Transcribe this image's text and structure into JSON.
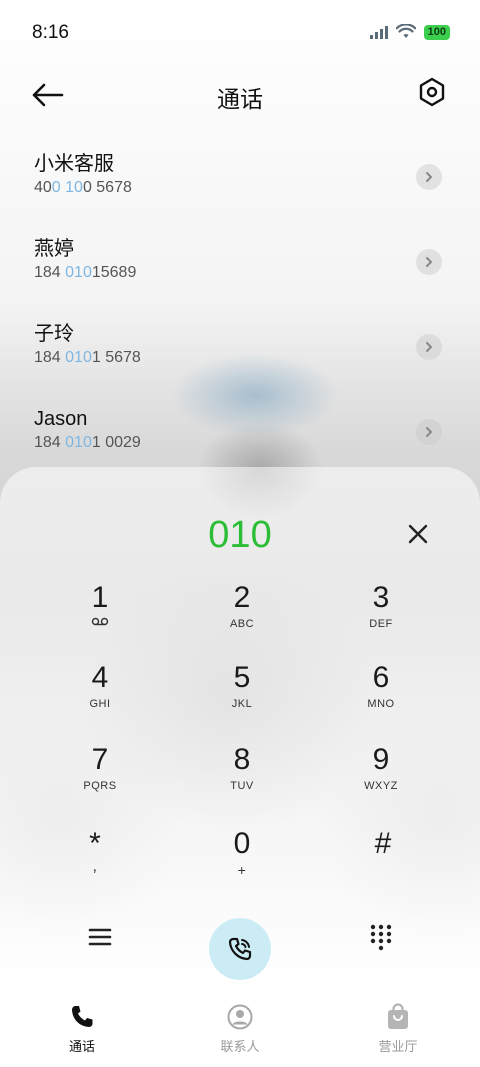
{
  "status_bar": {
    "time": "8:16",
    "battery": "100",
    "icons": [
      "signal-icon",
      "wifi-icon",
      "battery-icon"
    ]
  },
  "header": {
    "title": "通话",
    "back_icon": "arrow-left-icon",
    "settings_icon": "settings-hexagon-icon"
  },
  "contacts": [
    {
      "name": "小米客服",
      "number_pre": "40",
      "number_hl": "0 10",
      "number_post": "0 5678"
    },
    {
      "name": "燕婷",
      "number_pre": "184 ",
      "number_hl": "010",
      "number_post": "15689"
    },
    {
      "name": "子玲",
      "number_pre": "184 ",
      "number_hl": "010",
      "number_post": "1 5678"
    },
    {
      "name": "Jason",
      "number_pre": "184 ",
      "number_hl": "010",
      "number_post": "1 0029"
    }
  ],
  "dialer": {
    "input": "010",
    "keys": [
      {
        "digit": "1",
        "letters": "voicemail-icon"
      },
      {
        "digit": "2",
        "letters": "ABC"
      },
      {
        "digit": "3",
        "letters": "DEF"
      },
      {
        "digit": "4",
        "letters": "GHI"
      },
      {
        "digit": "5",
        "letters": "JKL"
      },
      {
        "digit": "6",
        "letters": "MNO"
      },
      {
        "digit": "7",
        "letters": "PQRS"
      },
      {
        "digit": "8",
        "letters": "TUV"
      },
      {
        "digit": "9",
        "letters": "WXYZ"
      },
      {
        "digit": "*",
        "letters": ","
      },
      {
        "digit": "0",
        "letters": "+"
      },
      {
        "digit": "#",
        "letters": ""
      }
    ]
  },
  "tabs": [
    {
      "label": "通话",
      "icon": "phone-icon",
      "active": true
    },
    {
      "label": "联系人",
      "icon": "contact-icon",
      "active": false
    },
    {
      "label": "营业厅",
      "icon": "shopping-bag-icon",
      "active": false
    }
  ],
  "colors": {
    "accent_green": "#2bbd36",
    "highlight_blue": "#7fb7e2",
    "call_button_bg": "#ccecf5"
  }
}
